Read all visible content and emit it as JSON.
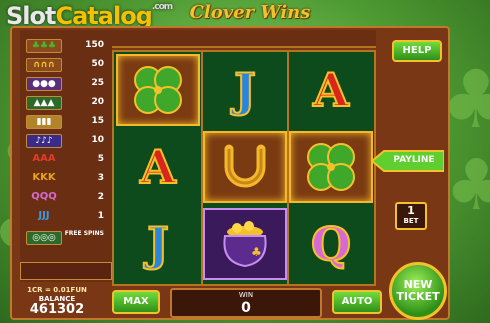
{
  "watermark": {
    "part1": "Slot",
    "part2": "Catalog",
    "part3": ".com"
  },
  "game_title": "Clover Wins",
  "paytable": [
    {
      "symbol": "shamrock",
      "pay": "150"
    },
    {
      "symbol": "horseshoe",
      "pay": "50"
    },
    {
      "symbol": "pot-of-gold",
      "pay": "25"
    },
    {
      "symbol": "top-hat",
      "pay": "20"
    },
    {
      "symbol": "beer",
      "pay": "15"
    },
    {
      "symbol": "pipe",
      "pay": "10"
    },
    {
      "symbol": "AAA",
      "pay": "5"
    },
    {
      "symbol": "KKK",
      "pay": "3"
    },
    {
      "symbol": "QQQ",
      "pay": "2"
    },
    {
      "symbol": "JJJ",
      "pay": "1"
    },
    {
      "symbol": "scatter",
      "pay": "FREE SPINS"
    }
  ],
  "reels": [
    [
      "clover",
      "A",
      "J"
    ],
    [
      "J",
      "horseshoe",
      "pot"
    ],
    [
      "A",
      "clover",
      "Q"
    ]
  ],
  "controls": {
    "help": "HELP",
    "payline": "PAYLINE",
    "bet_value": "1",
    "bet_label": "BET",
    "max": "MAX",
    "auto": "AUTO",
    "new_ticket": "NEW TICKET"
  },
  "info": {
    "credit": "1CR = 0.01FUN",
    "balance_label": "BALANCE",
    "balance": "461302",
    "win_label": "WIN",
    "win": "0"
  },
  "colors": {
    "gold": "#f3c12a",
    "frame": "#7a3716",
    "reel_bg": "#0d4a1c",
    "button_green": "#2f8f1a"
  }
}
